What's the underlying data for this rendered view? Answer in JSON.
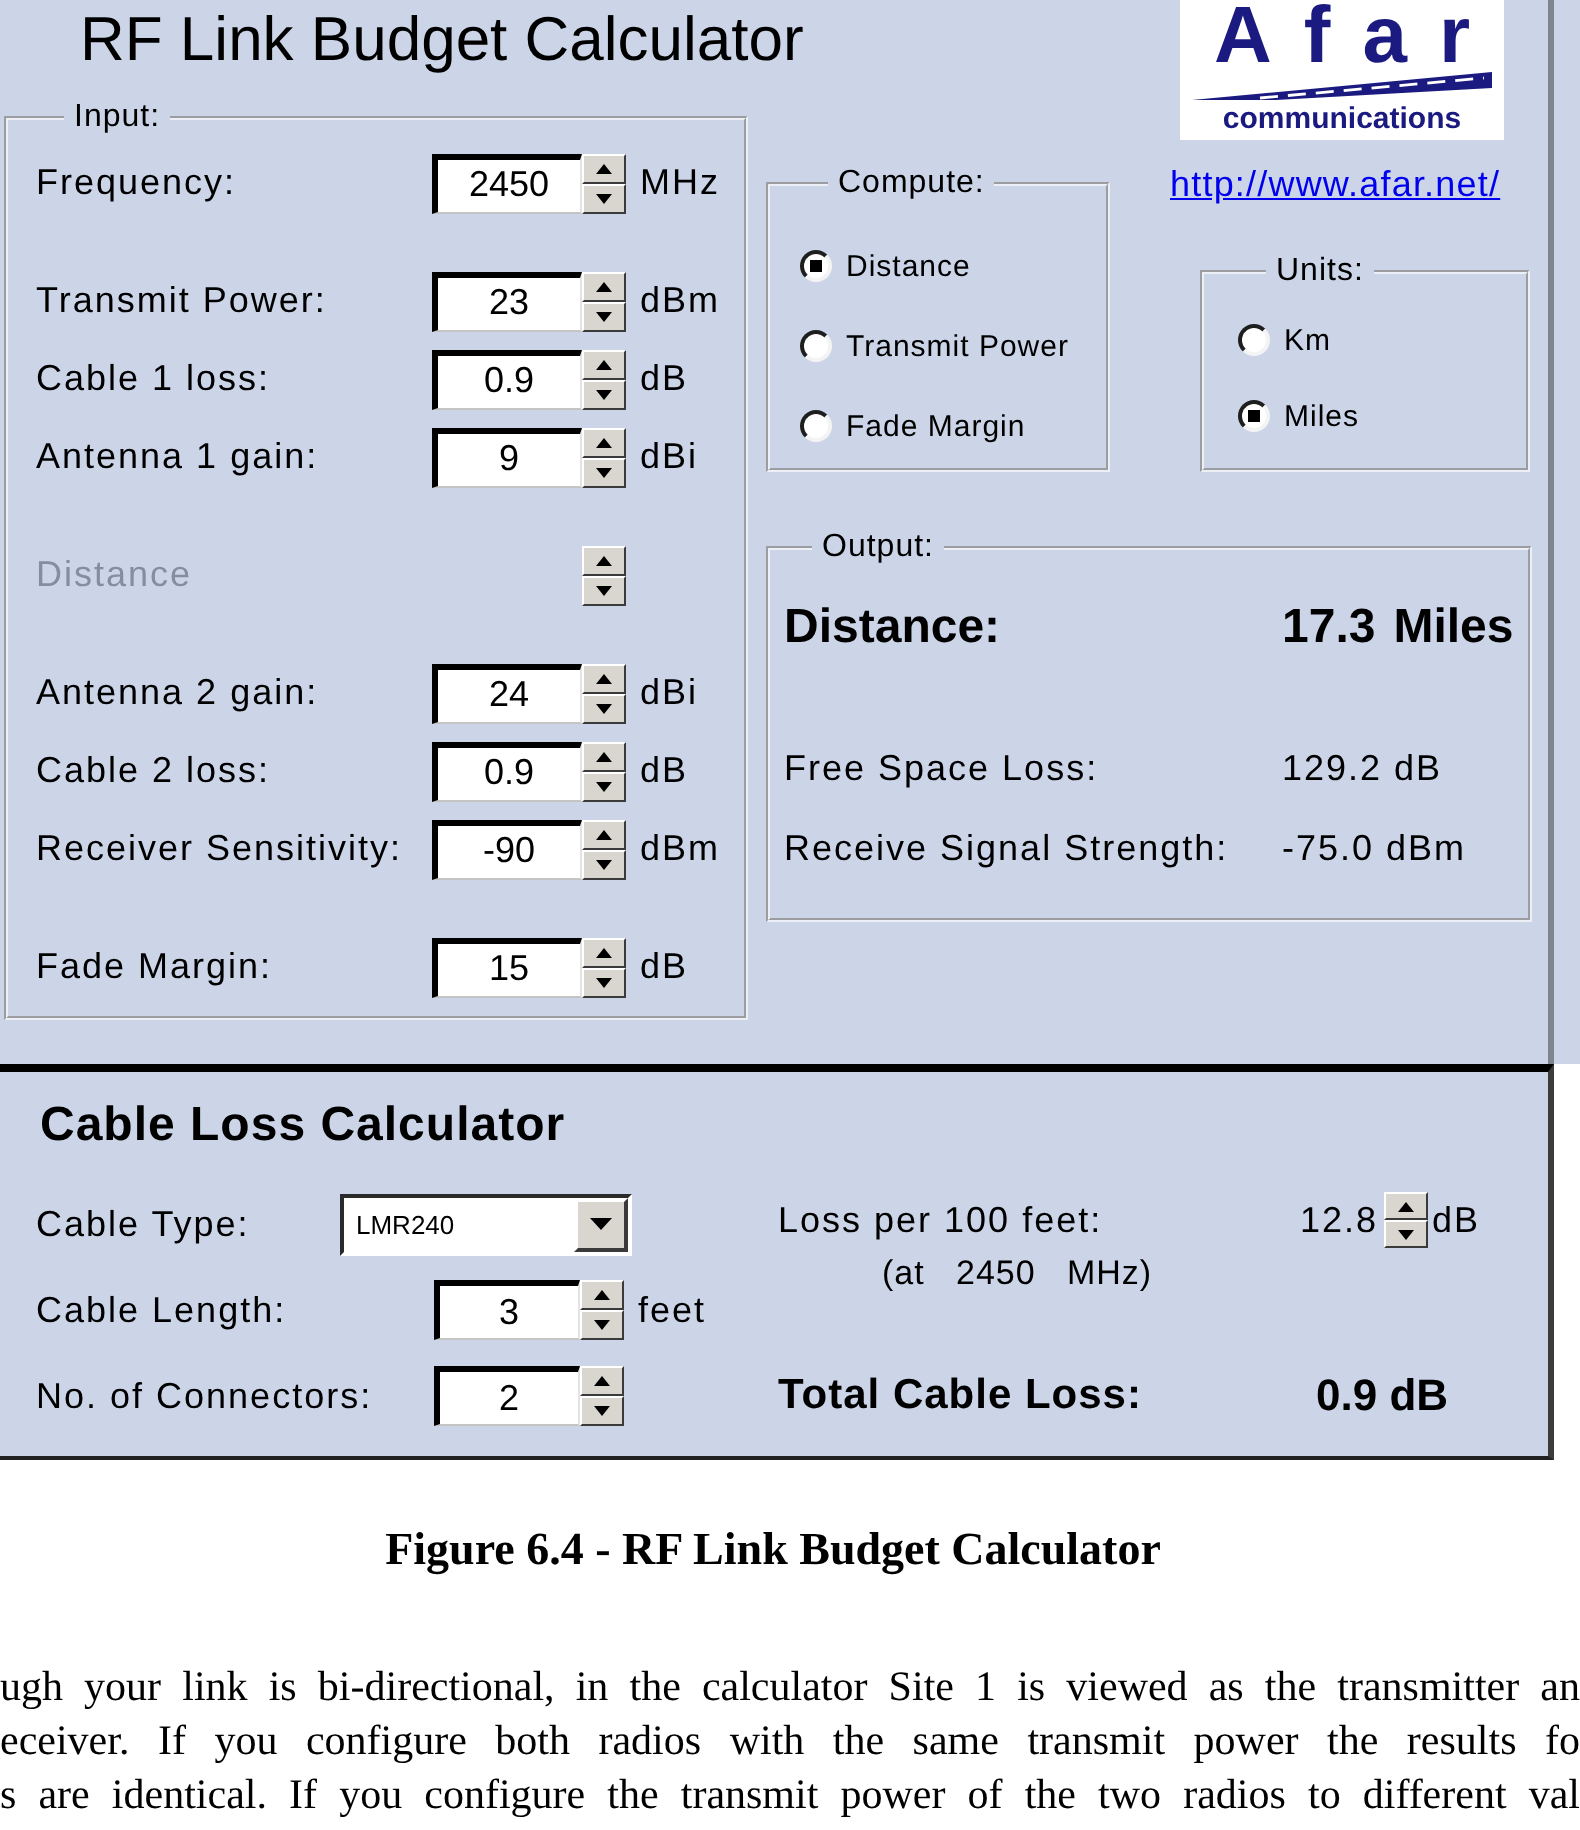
{
  "window": {
    "title": "RF Link Budget Calculator"
  },
  "logo": {
    "wordmark": "Afar",
    "tagline": "communications"
  },
  "website_link": "http://www.afar.net/",
  "input": {
    "legend": "Input:",
    "sections": [
      {
        "rows": [
          {
            "label": "Frequency:",
            "value": "2450",
            "unit": "MHz",
            "disabled": false
          }
        ]
      },
      {
        "rows": [
          {
            "label": "Transmit Power:",
            "value": "23",
            "unit": "dBm",
            "disabled": false
          },
          {
            "label": "Cable 1 loss:",
            "value": "0.9",
            "unit": "dB",
            "disabled": false
          },
          {
            "label": "Antenna 1 gain:",
            "value": "9",
            "unit": "dBi",
            "disabled": false
          }
        ]
      },
      {
        "rows": [
          {
            "label": "Distance",
            "disabled": true
          }
        ]
      },
      {
        "rows": [
          {
            "label": "Antenna 2 gain:",
            "value": "24",
            "unit": "dBi",
            "disabled": false
          },
          {
            "label": "Cable 2 loss:",
            "value": "0.9",
            "unit": "dB",
            "disabled": false
          },
          {
            "label": "Receiver Sensitivity:",
            "value": "-90",
            "unit": "dBm",
            "disabled": false
          }
        ]
      },
      {
        "rows": [
          {
            "label": "Fade Margin:",
            "value": "15",
            "unit": "dB",
            "disabled": false
          }
        ]
      }
    ]
  },
  "compute": {
    "legend": "Compute:",
    "options": [
      {
        "label": "Distance",
        "selected": true
      },
      {
        "label": "Transmit Power",
        "selected": false
      },
      {
        "label": "Fade Margin",
        "selected": false
      }
    ]
  },
  "units": {
    "legend": "Units:",
    "options": [
      {
        "label": "Km",
        "selected": false
      },
      {
        "label": "Miles",
        "selected": true
      }
    ]
  },
  "output": {
    "legend": "Output:",
    "result": {
      "label": "Distance:",
      "value": "17.3",
      "unit": "Miles"
    },
    "rows": [
      {
        "label": "Free Space Loss:",
        "value": "129.2 dB"
      },
      {
        "label": "Receive Signal Strength:",
        "value": "-75.0 dBm"
      }
    ]
  },
  "cable_loss": {
    "title": "Cable Loss Calculator",
    "cable_type": {
      "label": "Cable Type:",
      "value": "LMR240"
    },
    "fields": [
      {
        "label": "Cable Length:",
        "value": "3",
        "unit": "feet"
      },
      {
        "label": "No. of Connectors:",
        "value": "2"
      }
    ],
    "loss_per_100": {
      "label": "Loss per 100 feet:",
      "value": "12.8",
      "unit": "dB",
      "note": "(at   2450   MHz)"
    },
    "total": {
      "label": "Total Cable Loss:",
      "value": "0.9 dB"
    }
  },
  "caption": "Figure 6.4 - RF Link Budget Calculator",
  "body_lines": [
    "ugh your link is bi-directional, in the calculator Site 1 is viewed as the transmitter an",
    "eceiver.  If you configure both radios with the same transmit power the results fo",
    "s are identical.  If you configure the transmit power of the two radios to different val"
  ]
}
